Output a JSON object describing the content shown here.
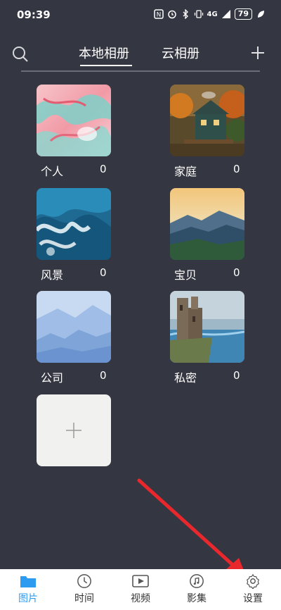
{
  "status_bar": {
    "time": "09:39",
    "network": "4G",
    "battery": "79"
  },
  "header": {
    "tabs": [
      {
        "label": "本地相册",
        "active": true
      },
      {
        "label": "云相册",
        "active": false
      }
    ],
    "search_icon": "search-icon",
    "add_icon": "plus-icon"
  },
  "albums": [
    {
      "name": "个人",
      "count": "0",
      "thumb": "pink-teal-abstract"
    },
    {
      "name": "家庭",
      "count": "0",
      "thumb": "cabin-in-forest"
    },
    {
      "name": "风景",
      "count": "0",
      "thumb": "ocean-wave"
    },
    {
      "name": "宝贝",
      "count": "0",
      "thumb": "mountain-sunset"
    },
    {
      "name": "公司",
      "count": "0",
      "thumb": "misty-blue-hills"
    },
    {
      "name": "私密",
      "count": "0",
      "thumb": "castle-ruins"
    }
  ],
  "add_album_icon": "plus-icon",
  "bottom_nav": [
    {
      "label": "图片",
      "icon": "folder-icon",
      "active": true
    },
    {
      "label": "时间",
      "icon": "clock-icon",
      "active": false
    },
    {
      "label": "视频",
      "icon": "video-icon",
      "active": false
    },
    {
      "label": "影集",
      "icon": "music-icon",
      "active": false
    },
    {
      "label": "设置",
      "icon": "gear-icon",
      "active": false
    }
  ],
  "colors": {
    "background": "#343641",
    "accent": "#2d9cf0",
    "annotation_arrow": "#e8282c"
  }
}
